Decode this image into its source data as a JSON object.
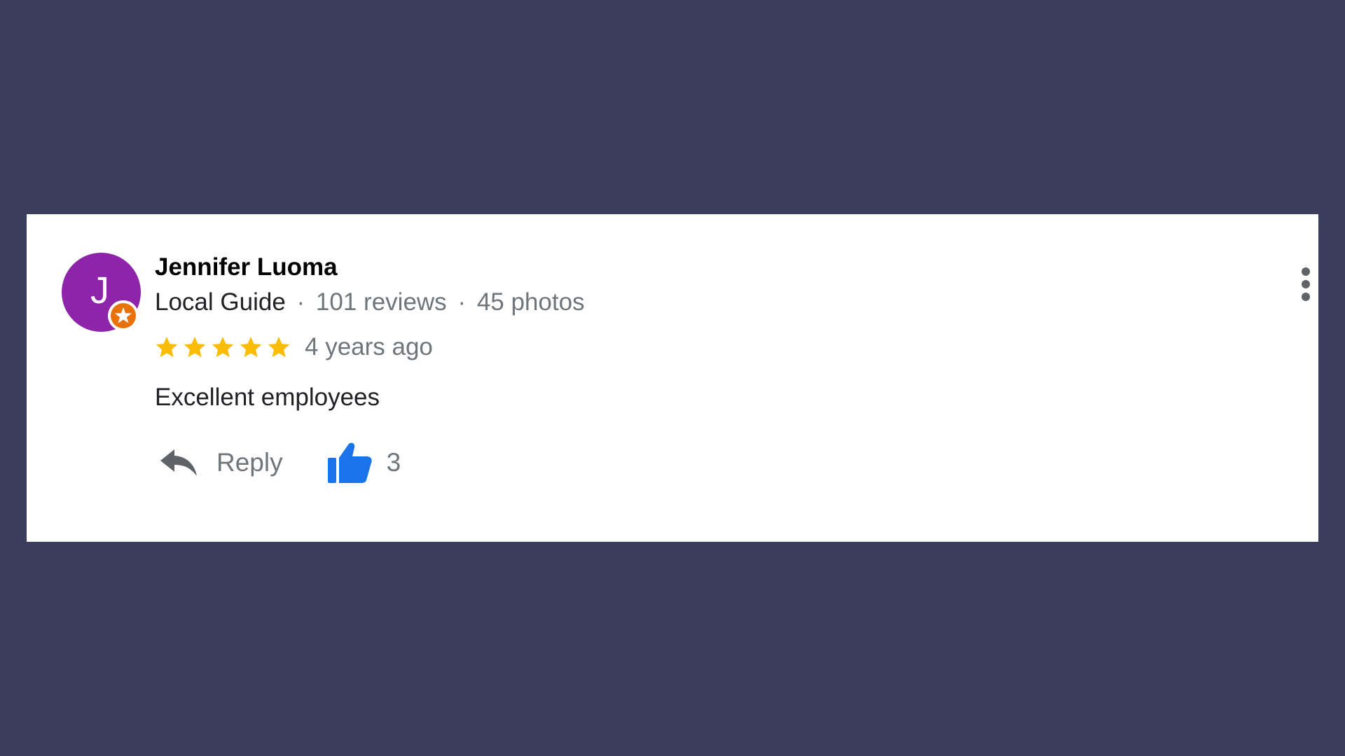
{
  "review": {
    "author": {
      "name": "Jennifer Luoma",
      "initial": "J",
      "avatar_color": "#8e24aa",
      "badge_icon": "local-guide-badge-icon",
      "badge_color": "#e8710a"
    },
    "meta": {
      "guide_label": "Local Guide",
      "separator": "·",
      "reviews": "101 reviews",
      "photos": "45 photos"
    },
    "rating": {
      "stars": 5,
      "max_stars": 5,
      "star_color": "#fbbc04"
    },
    "time_ago": "4 years ago",
    "text": "Excellent employees",
    "actions": {
      "reply_label": "Reply",
      "reply_icon": "reply-arrow-icon",
      "like_icon": "thumbs-up-icon",
      "like_count": "3",
      "like_color": "#1a73e8"
    },
    "more_icon": "more-vert-icon"
  },
  "colors": {
    "background": "#3b3d5c",
    "card": "#ffffff",
    "secondary_text": "#70757a"
  }
}
